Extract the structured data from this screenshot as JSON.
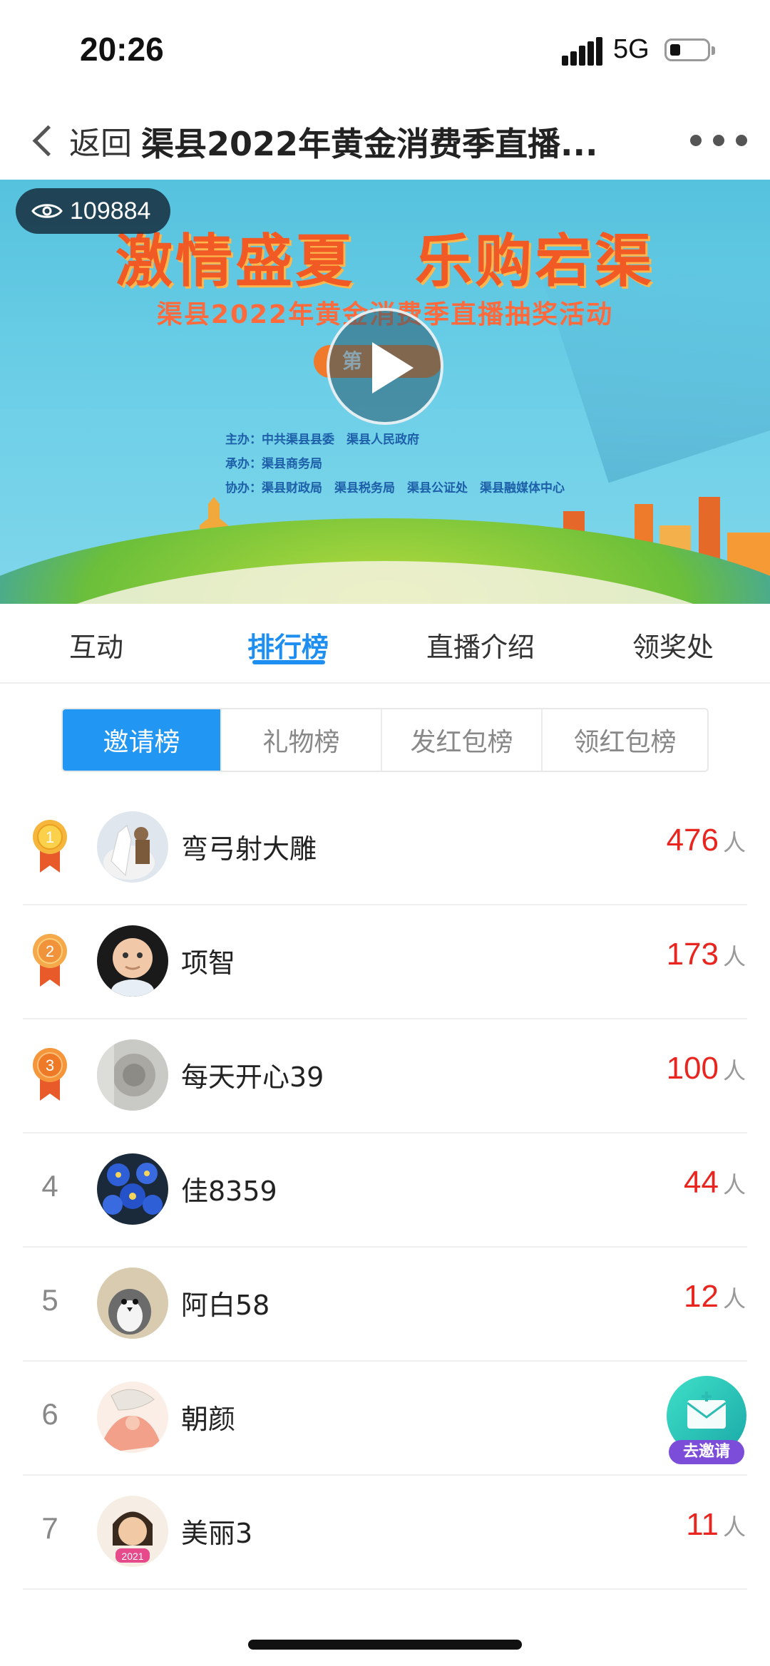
{
  "status_bar": {
    "time": "20:26",
    "network": "5G"
  },
  "nav": {
    "back_label": "返回",
    "title": "渠县2022年黄金消费季直播..."
  },
  "banner": {
    "views": "109884",
    "slogan": "激情盛夏　乐购宕渠",
    "subtitle": "渠县2022年黄金消费季直播抽奖活动",
    "period": "第",
    "organizers": [
      "主办：中共渠县县委　渠县人民政府",
      "承办：渠县商务局",
      "协办：渠县财政局　渠县税务局　渠县公证处　渠县融媒体中心"
    ]
  },
  "tabs": [
    {
      "label": "互动"
    },
    {
      "label": "排行榜"
    },
    {
      "label": "直播介绍"
    },
    {
      "label": "领奖处"
    }
  ],
  "board_tabs": [
    {
      "label": "邀请榜"
    },
    {
      "label": "礼物榜"
    },
    {
      "label": "发红包榜"
    },
    {
      "label": "领红包榜"
    }
  ],
  "ranking": [
    {
      "rank": "1",
      "name": "弯弓射大雕",
      "count": "476",
      "unit": "人"
    },
    {
      "rank": "2",
      "name": "项智",
      "count": "173",
      "unit": "人"
    },
    {
      "rank": "3",
      "name": "每天开心39",
      "count": "100",
      "unit": "人"
    },
    {
      "rank": "4",
      "name": "佳8359",
      "count": "44",
      "unit": "人"
    },
    {
      "rank": "5",
      "name": "阿白58",
      "count": "12",
      "unit": "人"
    },
    {
      "rank": "6",
      "name": "朝颜",
      "count": "",
      "unit": ""
    },
    {
      "rank": "7",
      "name": "美丽3",
      "count": "11",
      "unit": "人"
    }
  ],
  "invite_button": {
    "label": "去邀请"
  },
  "colors": {
    "accent": "#2196f3",
    "score": "#e8251e",
    "medal_gold": "#f6b63c",
    "ribbon": "#e85a2a"
  }
}
